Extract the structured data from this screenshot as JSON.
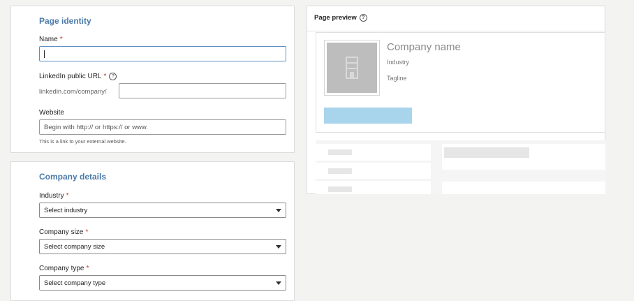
{
  "identity": {
    "title": "Page identity",
    "name_label": "Name",
    "name_value": "",
    "url_label": "LinkedIn public URL",
    "url_prefix": "linkedin.com/company/",
    "url_value": "",
    "website_label": "Website",
    "website_placeholder": "Begin with http:// or https:// or www.",
    "website_hint": "This is a link to your external website."
  },
  "details": {
    "title": "Company details",
    "industry_label": "Industry",
    "industry_value": "Select industry",
    "size_label": "Company size",
    "size_value": "Select company size",
    "type_label": "Company type",
    "type_value": "Select company type"
  },
  "preview": {
    "title": "Page preview",
    "company_name": "Company name",
    "industry": "Industry",
    "tagline": "Tagline"
  },
  "required_mark": "*",
  "help_glyph": "?",
  "colors": {
    "section_title": "#4b7aa9",
    "focus_border": "#5c8fc4",
    "preview_button": "#a8d4ec",
    "logo_placeholder": "#bdbdbd"
  }
}
